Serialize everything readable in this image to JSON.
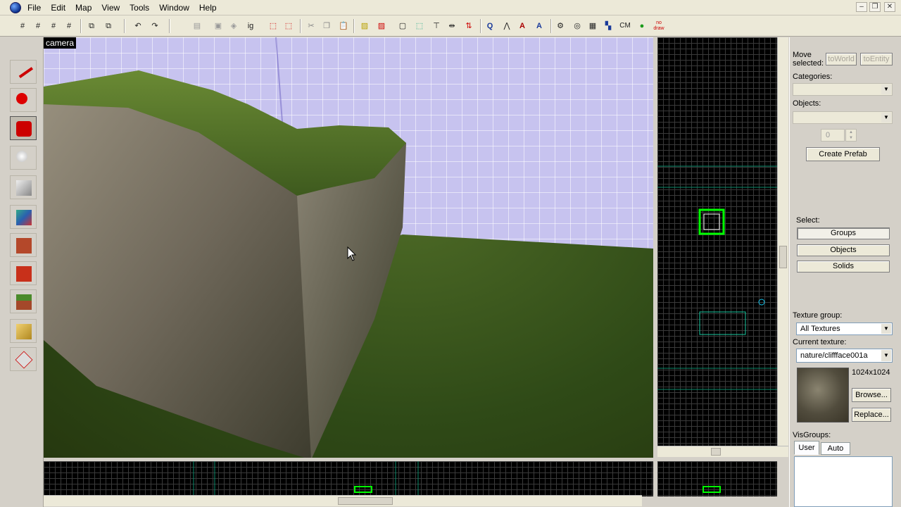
{
  "menu": [
    "File",
    "Edit",
    "Map",
    "View",
    "Tools",
    "Window",
    "Help"
  ],
  "toolbar": {
    "ig_label": "ig",
    "cm_label": "CM",
    "nodraw_label": "no draw"
  },
  "camera": {
    "label": "camera"
  },
  "panel": {
    "move_selected": "Move selected:",
    "to_world": "toWorld",
    "to_entity": "toEntity",
    "categories_label": "Categories:",
    "categories_value": "",
    "objects_label": "Objects:",
    "objects_value": "",
    "count_value": "0",
    "create_prefab": "Create Prefab",
    "select_label": "Select:",
    "select_groups": "Groups",
    "select_objects": "Objects",
    "select_solids": "Solids",
    "texture_group_label": "Texture group:",
    "texture_group_value": "All Textures",
    "current_texture_label": "Current texture:",
    "current_texture_value": "nature/cliffface001a",
    "texture_size": "1024x1024",
    "browse": "Browse...",
    "replace": "Replace...",
    "visgroups_label": "VisGroups:",
    "tab_user": "User",
    "tab_auto": "Auto"
  },
  "colors": {
    "accent_selection": "#00ff00",
    "grid_line": "#3a3a3a",
    "wall_tint": "#c7c3ef",
    "floor_grass": "#3e5a1e"
  },
  "icons": [
    "app-globe-icon",
    "grid-icon",
    "undo-icon",
    "redo-icon",
    "select-tool-icon",
    "magnify-tool-icon",
    "camera-tool-icon",
    "entity-tool-icon",
    "block-tool-icon",
    "texture-tool-icon",
    "clip-tool-icon",
    "vertex-tool-icon"
  ]
}
